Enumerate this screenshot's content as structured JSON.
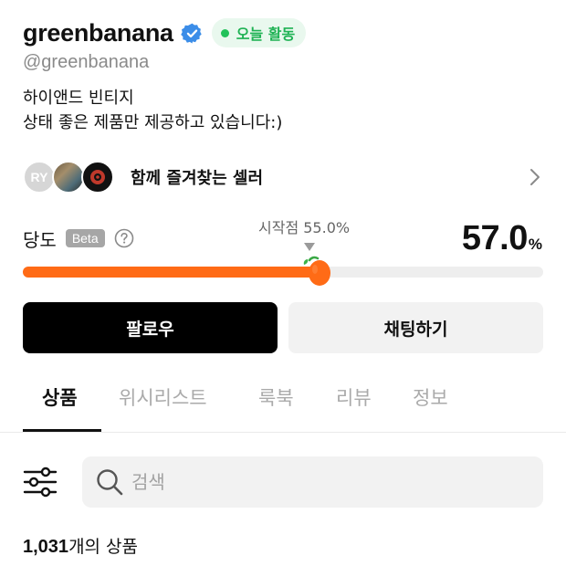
{
  "profile": {
    "username": "greenbanana",
    "handle": "@greenbanana",
    "active_badge": "오늘 활동",
    "bio_lines": [
      "하이앤드 빈티지",
      "상태 좋은 제품만 제공하고 있습니다:)"
    ]
  },
  "sellers": {
    "avatar_initials": "RY",
    "label": "함께 즐겨찾는 셀러"
  },
  "dangdo": {
    "label": "당도",
    "beta": "Beta",
    "start_label": "시작점 55.0%",
    "start_value": 55.0,
    "value_text": "57.0",
    "value_unit": "%",
    "value": 57.0
  },
  "actions": {
    "follow": "팔로우",
    "chat": "채팅하기"
  },
  "tabs": [
    {
      "label": "상품",
      "active": true
    },
    {
      "label": "위시리스트",
      "active": false
    },
    {
      "label": "룩북",
      "active": false
    },
    {
      "label": "리뷰",
      "active": false
    },
    {
      "label": "정보",
      "active": false
    }
  ],
  "search": {
    "placeholder": "검색"
  },
  "products": {
    "count": "1,031",
    "suffix": "개의 상품"
  },
  "colors": {
    "accent_orange": "#ff6b16",
    "active_green": "#22c25a",
    "verified_blue": "#3b8de8"
  },
  "icons": [
    "verified-icon",
    "help-icon",
    "chevron-right-icon",
    "filter-icon",
    "search-icon",
    "tomato-icon"
  ]
}
